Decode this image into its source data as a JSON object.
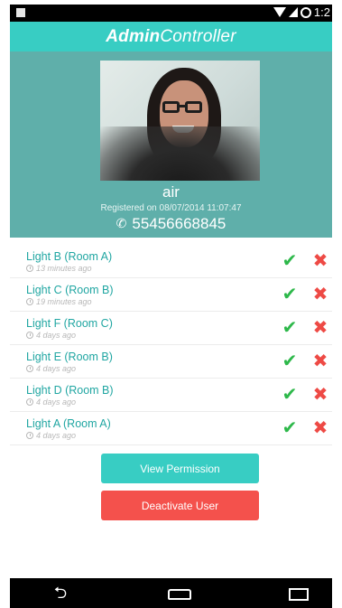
{
  "app": {
    "title_bold": "Admin",
    "title_regular": "Controller",
    "status_time": "1:2"
  },
  "user": {
    "name": "air",
    "registered": "Registered on 08/07/2014 11:07:47",
    "phone": "55456668845"
  },
  "requests": [
    {
      "title": "Light B (Room A)",
      "time": "13 minutes ago"
    },
    {
      "title": "Light C (Room B)",
      "time": "19 minutes ago"
    },
    {
      "title": "Light F (Room C)",
      "time": "4 days ago"
    },
    {
      "title": "Light E (Room B)",
      "time": "4 days ago"
    },
    {
      "title": "Light D (Room B)",
      "time": "4 days ago"
    },
    {
      "title": "Light A (Room A)",
      "time": "4 days ago"
    }
  ],
  "buttons": {
    "view_permission": "View Permission",
    "deactivate_user": "Deactivate User"
  },
  "icons": {
    "approve": "checkmark-icon",
    "deny": "close-icon",
    "clock": "clock-icon",
    "phone": "phone-icon"
  },
  "colors": {
    "accent": "#38cdc3",
    "profile_bg": "#5fafaa",
    "approve": "#2db84a",
    "deny": "#ee4a45",
    "deactivate": "#f4514c",
    "list_title": "#20a6a2"
  }
}
